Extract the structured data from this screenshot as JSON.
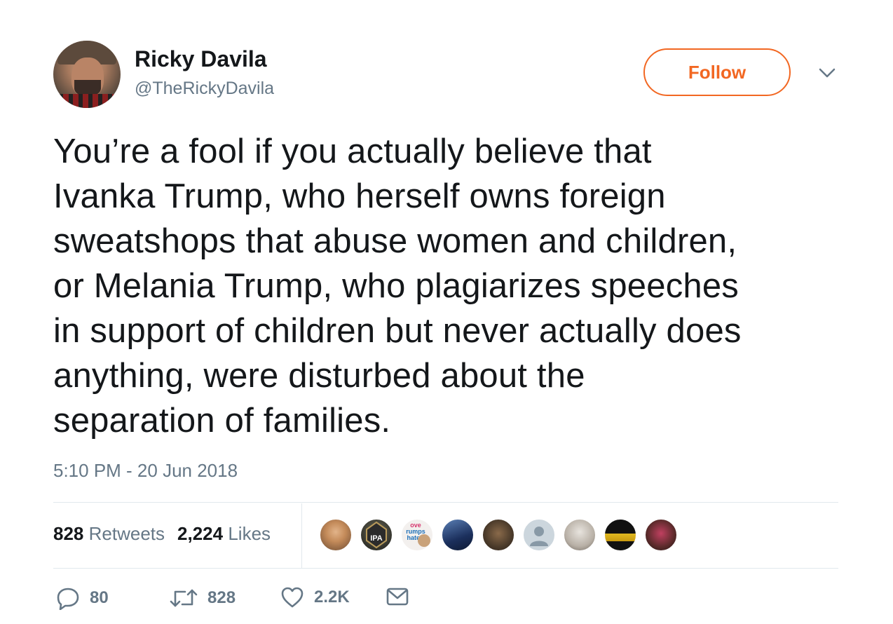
{
  "author": {
    "name": "Ricky Davila",
    "handle": "@TheRickyDavila"
  },
  "follow_label": "Follow",
  "tweet": {
    "lines": [
      "You’re a fool if you actually believe that",
      "Ivanka Trump, who herself owns foreign",
      "sweatshops that abuse women and children,",
      "or Melania Trump, who plagiarizes speeches",
      "in support of children but never actually does",
      "anything, were disturbed about the",
      "separation of families."
    ],
    "timestamp": "5:10 PM - 20 Jun 2018"
  },
  "stats": {
    "retweets_count": "828",
    "retweets_label": "Retweets",
    "likes_count": "2,224",
    "likes_label": "Likes"
  },
  "actions": {
    "reply_count": "80",
    "retweet_count": "828",
    "like_count": "2.2K"
  },
  "liker_avatar_texts": [
    "ove",
    "rumps",
    "hate.",
    "IPA"
  ],
  "colors": {
    "accent": "#f26722",
    "text": "#14171a",
    "secondary": "#657786",
    "divider": "#e1e8ed"
  },
  "icons": [
    "chevron-down-icon",
    "reply-icon",
    "retweet-icon",
    "like-icon",
    "message-icon"
  ]
}
